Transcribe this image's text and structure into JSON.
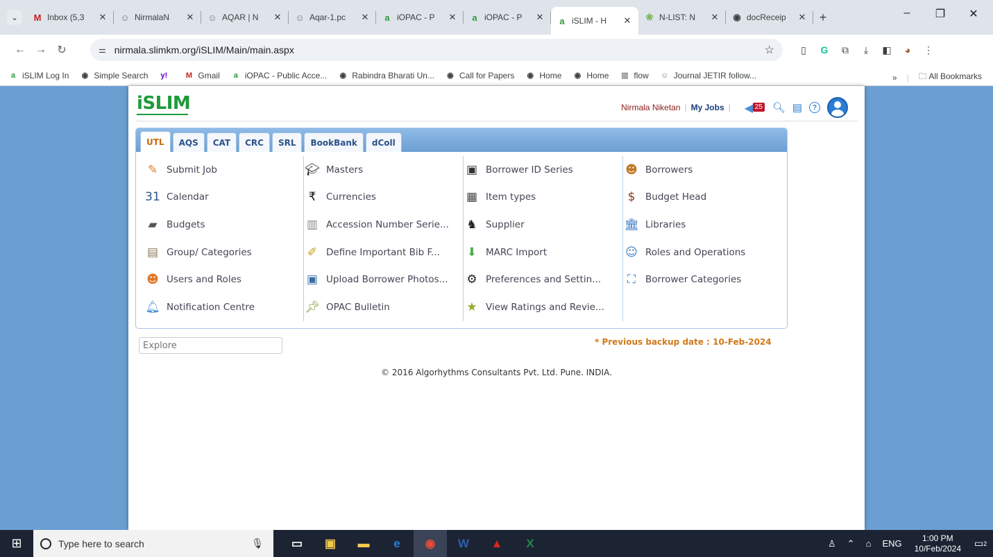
{
  "browser": {
    "tabs": [
      {
        "title": "Inbox (5,3",
        "favicon": "M",
        "color": "#c5221f"
      },
      {
        "title": "NirmalaN",
        "favicon": "☺",
        "color": "#777777"
      },
      {
        "title": "AQAR | N",
        "favicon": "☺",
        "color": "#777777"
      },
      {
        "title": "Aqar-1.pc",
        "favicon": "☺",
        "color": "#777777"
      },
      {
        "title": "iOPAC - P",
        "favicon": "a",
        "color": "#2e9a3b"
      },
      {
        "title": "iOPAC - P",
        "favicon": "a",
        "color": "#2e9a3b"
      },
      {
        "title": "iSLIM - H",
        "favicon": "a",
        "color": "#2e9a3b",
        "active": true
      },
      {
        "title": "N-LIST: N",
        "favicon": "❀",
        "color": "#7ab55c"
      },
      {
        "title": "docReceip",
        "favicon": "◉",
        "color": "#3c4043"
      }
    ],
    "new_tab": "+",
    "url": "nirmala.slimkm.org/iSLIM/Main/main.aspx",
    "bookmarks": [
      {
        "label": "iSLIM Log In",
        "icon": "a",
        "color": "#2e9a3b"
      },
      {
        "label": "Simple Search",
        "icon": "◉",
        "color": "#3c4043"
      },
      {
        "label": "",
        "icon": "y!",
        "color": "#6001d2"
      },
      {
        "label": "Gmail",
        "icon": "M",
        "color": "#c5221f"
      },
      {
        "label": "iOPAC - Public Acce...",
        "icon": "a",
        "color": "#2e9a3b"
      },
      {
        "label": "Rabindra Bharati Un...",
        "icon": "◉",
        "color": "#3c4043"
      },
      {
        "label": "Call for Papers",
        "icon": "◉",
        "color": "#3c4043"
      },
      {
        "label": "Home",
        "icon": "◉",
        "color": "#3c4043"
      },
      {
        "label": "Home",
        "icon": "◉",
        "color": "#3c4043"
      },
      {
        "label": "flow",
        "icon": "▥",
        "color": "#888888"
      },
      {
        "label": "Journal JETIR follow...",
        "icon": "☺",
        "color": "#777777"
      }
    ],
    "more_bookmarks": "»",
    "all_bookmarks": "All Bookmarks"
  },
  "app": {
    "logo": "iSLIM",
    "institution": "Nirmala Niketan",
    "my_jobs": "My Jobs",
    "notification_count": "25",
    "modules": [
      {
        "label": "UTL",
        "active": true
      },
      {
        "label": "AQS"
      },
      {
        "label": "CAT"
      },
      {
        "label": "CRC"
      },
      {
        "label": "SRL"
      },
      {
        "label": "BookBank"
      },
      {
        "label": "dColl"
      }
    ],
    "columns": [
      [
        {
          "label": "Submit Job",
          "icon": "pencil-icon",
          "glyph": "✎",
          "color": "#d9822b"
        },
        {
          "label": "Calendar",
          "icon": "calendar-icon",
          "glyph": "31",
          "color": "#2b5289"
        },
        {
          "label": "Budgets",
          "icon": "wallet-icon",
          "glyph": "▰",
          "color": "#555555"
        },
        {
          "label": "Group/ Categories",
          "icon": "folder-icon",
          "glyph": "▤",
          "color": "#8c7a5b"
        },
        {
          "label": "Users and Roles",
          "icon": "users-icon",
          "glyph": "☻",
          "color": "#e0782a"
        },
        {
          "label": "Notification Centre",
          "icon": "bell-icon",
          "glyph": "🔔︎",
          "color": "#4c8fd6"
        }
      ],
      [
        {
          "label": "Masters",
          "icon": "mortarboard-icon",
          "glyph": "🎓︎",
          "color": "#222222"
        },
        {
          "label": "Currencies",
          "icon": "rupee-icon",
          "glyph": "₹",
          "color": "#111111"
        },
        {
          "label": "Accession Number Serie...",
          "icon": "columns-icon",
          "glyph": "▥",
          "color": "#888888"
        },
        {
          "label": "Define Important Bib F...",
          "icon": "note-icon",
          "glyph": "✐",
          "color": "#c99a10"
        },
        {
          "label": "Upload Borrower Photos...",
          "icon": "photo-upload-icon",
          "glyph": "▣",
          "color": "#3a6ea5"
        },
        {
          "label": "OPAC Bulletin",
          "icon": "pin-icon",
          "glyph": "📌︎",
          "color": "#7a9a2b"
        }
      ],
      [
        {
          "label": "Borrower ID Series",
          "icon": "id-card-icon",
          "glyph": "▣",
          "color": "#333333"
        },
        {
          "label": "Item types",
          "icon": "item-types-icon",
          "glyph": "▦",
          "color": "#444444"
        },
        {
          "label": "Supplier",
          "icon": "supplier-icon",
          "glyph": "♞",
          "color": "#222222"
        },
        {
          "label": "MARC Import",
          "icon": "import-icon",
          "glyph": "⬇",
          "color": "#4caf50"
        },
        {
          "label": "Preferences and Settin...",
          "icon": "gears-icon",
          "glyph": "⚙",
          "color": "#222222"
        },
        {
          "label": "View Ratings and Revie...",
          "icon": "star-icon",
          "glyph": "★",
          "color": "#9aa82b"
        }
      ],
      [
        {
          "label": "Borrowers",
          "icon": "borrowers-icon",
          "glyph": "☻",
          "color": "#c07a2b"
        },
        {
          "label": "Budget Head",
          "icon": "money-bag-icon",
          "glyph": "$",
          "color": "#8b3a1a"
        },
        {
          "label": "Libraries",
          "icon": "library-icon",
          "glyph": "🏛︎",
          "color": "#3a78c4"
        },
        {
          "label": "Roles and Operations",
          "icon": "role-icon",
          "glyph": "☺",
          "color": "#3a78c4"
        },
        {
          "label": "Borrower Categories",
          "icon": "hierarchy-icon",
          "glyph": "⛶",
          "color": "#2b7dd4"
        }
      ]
    ],
    "explore_placeholder": "Explore",
    "backup_note": "* Previous backup date : 10-Feb-2024",
    "copyright": "© 2016 Algorhythms Consultants Pvt. Ltd. Pune. INDIA."
  },
  "taskbar": {
    "search_placeholder": "Type here to search",
    "language": "ENG",
    "time": "1:00 PM",
    "date": "10/Feb/2024",
    "notifications": "2"
  }
}
